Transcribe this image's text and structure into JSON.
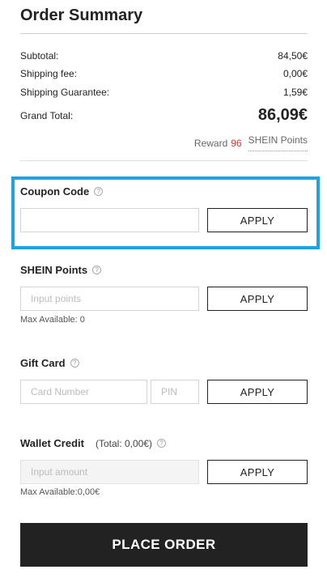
{
  "summary": {
    "title": "Order Summary",
    "subtotal_label": "Subtotal:",
    "subtotal_value": "84,50€",
    "shipping_label": "Shipping fee:",
    "shipping_value": "0,00€",
    "guarantee_label": "Shipping Guarantee:",
    "guarantee_value": "1,59€",
    "grand_label": "Grand Total:",
    "grand_value": "86,09€",
    "reward_label": "Reward",
    "reward_points": "96",
    "reward_unit": "SHEIN Points"
  },
  "coupon": {
    "title": "Coupon Code",
    "input_value": "",
    "apply_label": "APPLY"
  },
  "points": {
    "title": "SHEIN Points",
    "placeholder": "Input points",
    "apply_label": "APPLY",
    "max_available": "Max Available: 0"
  },
  "gift_card": {
    "title": "Gift Card",
    "number_placeholder": "Card Number",
    "pin_placeholder": "PIN",
    "apply_label": "APPLY"
  },
  "wallet": {
    "title": "Wallet Credit",
    "total_note": "(Total: 0,00€)",
    "placeholder": "Input amount",
    "apply_label": "APPLY",
    "max_available": "Max Available:0,00€"
  },
  "place_order_label": "PLACE ORDER",
  "colors": {
    "highlight": "#1fa3e0",
    "reward_number": "#d0382b",
    "primary_button": "#222222"
  },
  "icons": {
    "help": "question-circle-icon"
  }
}
